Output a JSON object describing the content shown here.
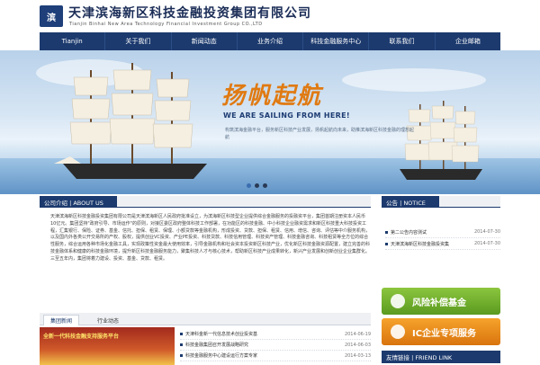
{
  "header": {
    "logo_text": "滨",
    "company_cn": "天津滨海新区科技金融投资集团有限公司",
    "company_en": "Tianjin Binhai New Area Technology Financial Investment Group CO.,LTD"
  },
  "nav": {
    "items": [
      "Tianjin",
      "关于我们",
      "新闻动态",
      "业务介绍",
      "科技金融服务中心",
      "联系我们",
      "企业邮箱"
    ]
  },
  "banner": {
    "slogan_cn": "扬帆起航",
    "slogan_en": "WE ARE SAILING FROM HERE!",
    "desc": "构筑滨海金融平台，服务新区科技产业发展，扬帆起航向未来，助推滨海新区科技金融的理想起航",
    "dots": 3,
    "active_dot": 1
  },
  "about": {
    "title": "公司介绍 | ABOUT US",
    "body": "天津滨海新区科技金融投资集团有限公司是天津滨海新区人民政府批准设立，为滨海新区科技型企业提供综合金融服务的投融资平台，集团首期注册资本人民币10亿元。集团坚持\"政府引导、市场运作\"的原则，对接区委区政府整体科技工作部署，在功能区的科技金融、中小科技企业融资需求和新区科技重大科技投资工程，汇集银行、保险、证券、基金、信托、担保、租赁、保理、小额贷款等金融机构，形成投资、贷款、担保、租赁、信用、增信、咨询、评估等中介服务机构，以及国内外各类公开交易所的产权、股权，提供创业VC投资、产业PE投资、科技贷款、科技信用管理、科技资产管理、科技金融咨询、科技租赁等全方位的综合性服务，综合运用各种市场化金融工具，实现政策性资金最大使用效率，引导金融机构和社会资本投资新区科技产业，优化新区科技金融资源配置，建立完善的科技金融体系和健康的科技金融环境，提升新区科技金融服务能力，聚集科技人才与核心技术，帮助新区科技产业成果转化，新兴产业发展和创新创业企业集群化。三至五年内，集团将着力建设、投资、基金、贷款、租赁。"
  },
  "news": {
    "tabs": [
      "集团新闻",
      "行业动态"
    ],
    "image_caption": "全新一代科技金融支持服务平台",
    "items": [
      {
        "title": "天津科金新一代信息技术创业投资基",
        "date": "2014-06-19"
      },
      {
        "title": "科技金融集团召开发展战略研究",
        "date": "2014-06-03"
      },
      {
        "title": "科技金融服务中心建设运行方案专家",
        "date": "2014-03-13"
      }
    ]
  },
  "notice": {
    "title": "公告 | NOTICE",
    "items": [
      {
        "title": "第二公告内容测试",
        "date": "2014-07-30"
      },
      {
        "title": "天津滨海新区科技金融投资集",
        "date": "2014-07-30"
      }
    ]
  },
  "sidebar": {
    "btn_green": "风险补偿基金",
    "btn_orange": "IC企业专项服务",
    "links_title": "友情链接 | FRIEND LINK"
  },
  "colors": {
    "nav_bg": "#1c3a6e",
    "accent_orange": "#e07a12",
    "btn_green": "#6aaa28",
    "btn_orange": "#e98a1c"
  }
}
